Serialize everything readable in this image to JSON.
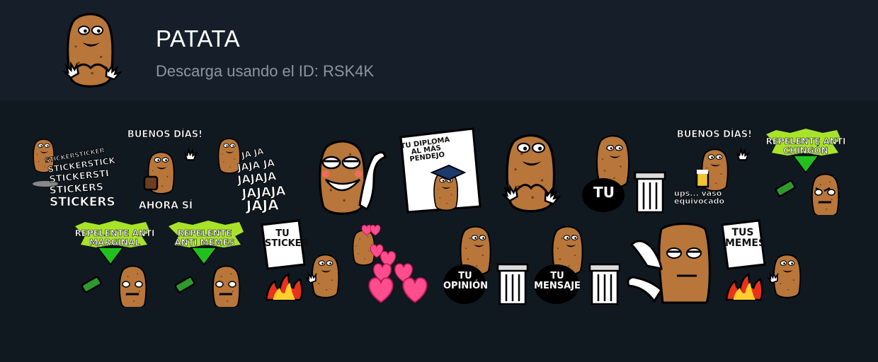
{
  "pack": {
    "title": "PATATA",
    "subtitle": "Descarga usando el ID: RSK4K",
    "icon": "potato-heart-hands-icon"
  },
  "colors": {
    "background": "#101820",
    "header": "#161f29",
    "potato": "#b8763a",
    "title": "#ffffff",
    "subtitle": "#8c96a0"
  },
  "stickers": [
    {
      "id": "s1",
      "icon": "potato-stickers-icon",
      "caption": "STICKERS"
    },
    {
      "id": "s2",
      "icon": "potato-coffee-icon",
      "caption_top": "BUENOS DÍAS!",
      "caption_bottom": "AHORA SÍ"
    },
    {
      "id": "s3",
      "icon": "potato-laughing-icon",
      "caption": "JAJAJA"
    },
    {
      "id": "s4",
      "icon": "potato-smug-icon"
    },
    {
      "id": "s5",
      "icon": "potato-diploma-icon",
      "caption": "TU DIPLOMA AL MÁS PENDEJO"
    },
    {
      "id": "s6",
      "icon": "potato-heart-hands-icon"
    },
    {
      "id": "s7",
      "icon": "potato-trash-icon",
      "caption": "TU"
    },
    {
      "id": "s8",
      "icon": "potato-beer-icon",
      "caption_top": "BUENOS DÍAS!",
      "caption_bottom": "ups... vaso equivocado"
    },
    {
      "id": "s9",
      "icon": "potato-repellent-icon",
      "caption": "REPELENTE ANTI CHINGÓN"
    },
    {
      "id": "s10",
      "icon": "potato-repellent-icon",
      "caption": "REPELENTE ANTI MARGINAL"
    },
    {
      "id": "s11",
      "icon": "potato-repellent-icon",
      "caption": "REPELENTE ANTI MEMES"
    },
    {
      "id": "s12",
      "icon": "potato-burning-sign-icon",
      "caption": "TU STICKER"
    },
    {
      "id": "s13",
      "icon": "potato-hearts-icon"
    },
    {
      "id": "s14",
      "icon": "potato-trash-icon",
      "caption": "TU OPINIÓN"
    },
    {
      "id": "s15",
      "icon": "potato-trash-icon",
      "caption": "TU MENSAJE"
    },
    {
      "id": "s16",
      "icon": "potato-bored-icon"
    },
    {
      "id": "s17",
      "icon": "potato-burning-sign-icon",
      "caption": "TUS MEMES"
    }
  ]
}
